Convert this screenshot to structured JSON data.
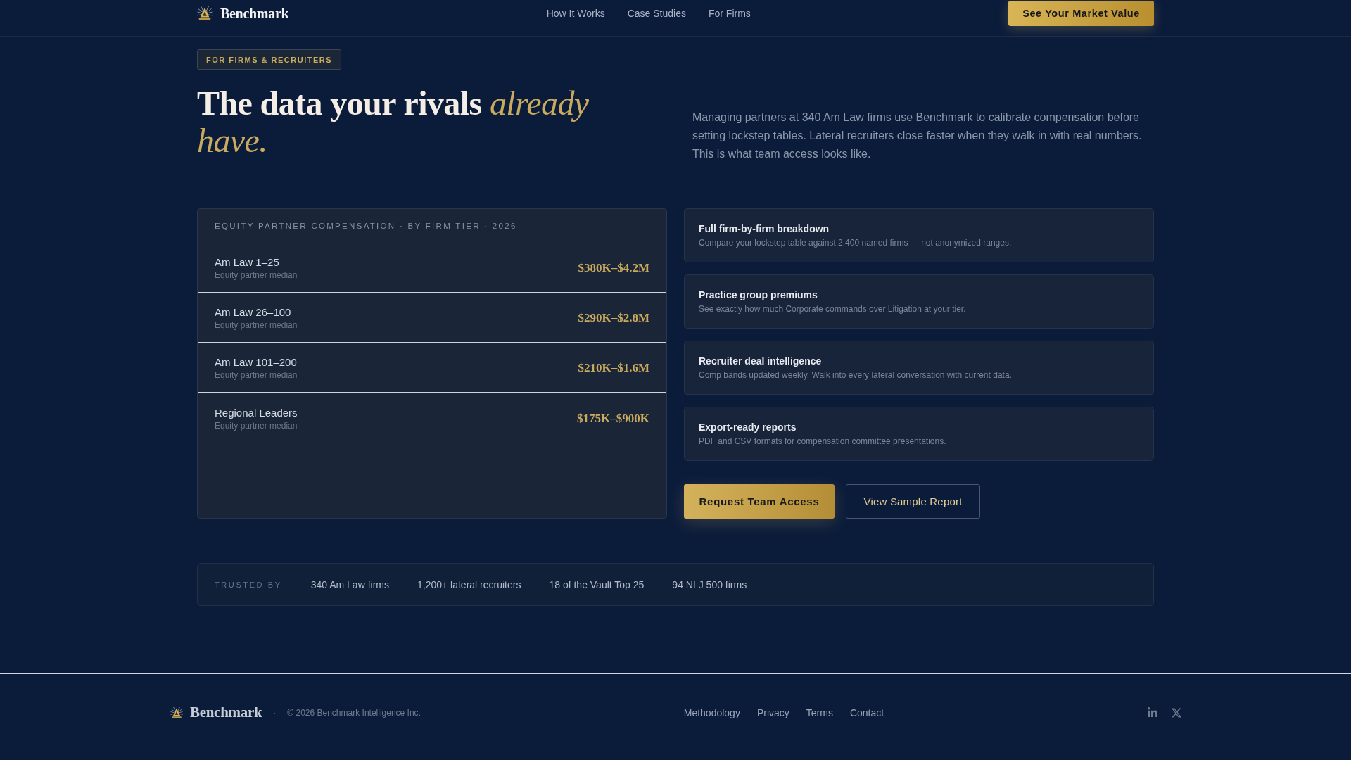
{
  "header": {
    "brand": "Benchmark",
    "nav": [
      "How It Works",
      "Case Studies",
      "For Firms"
    ],
    "cta": "See Your Market Value"
  },
  "hero": {
    "badge": "FOR FIRMS & RECRUITERS",
    "headline": "The data your rivals *already have.*",
    "intro": "Managing partners at 340 Am Law firms use Benchmark to calibrate compensation before setting lockstep tables. Lateral recruiters close faster when they walk in with real numbers. This is what team access looks like."
  },
  "comp_table": {
    "title": "EQUITY PARTNER COMPENSATION · BY FIRM TIER · 2026",
    "rows": [
      {
        "tier": "Am Law 1–25",
        "caption": "Equity partner median",
        "range": "$380K–$4.2M"
      },
      {
        "tier": "Am Law 26–100",
        "caption": "Equity partner median",
        "range": "$290K–$2.8M"
      },
      {
        "tier": "Am Law 101–200",
        "caption": "Equity partner median",
        "range": "$210K–$1.6M"
      },
      {
        "tier": "Regional Leaders",
        "caption": "Equity partner median",
        "range": "$175K–$900K"
      }
    ]
  },
  "features": [
    {
      "title": "Full firm-by-firm breakdown",
      "description": "Compare your lockstep table against 2,400 named firms — not anonymized ranges."
    },
    {
      "title": "Practice group premiums",
      "description": "See exactly how much Corporate commands over Litigation at your tier."
    },
    {
      "title": "Recruiter deal intelligence",
      "description": "Comp bands updated weekly. Walk into every lateral conversation with current data."
    },
    {
      "title": "Export-ready reports",
      "description": "PDF and CSV formats for compensation committee presentations."
    }
  ],
  "actions": [
    {
      "label": "Request Team Access",
      "kind": "primary"
    },
    {
      "label": "View Sample Report",
      "kind": "secondary"
    }
  ],
  "trusted": {
    "label": "TRUSTED BY",
    "items": [
      "340 Am Law firms",
      "1,200+ lateral recruiters",
      "18 of the Vault Top 25",
      "94 NLJ 500 firms"
    ]
  },
  "footer": {
    "brand": "Benchmark",
    "separator": "·",
    "copyright": "© 2026 Benchmark Intelligence Inc.",
    "links": [
      "Methodology",
      "Privacy",
      "Terms",
      "Contact"
    ]
  }
}
